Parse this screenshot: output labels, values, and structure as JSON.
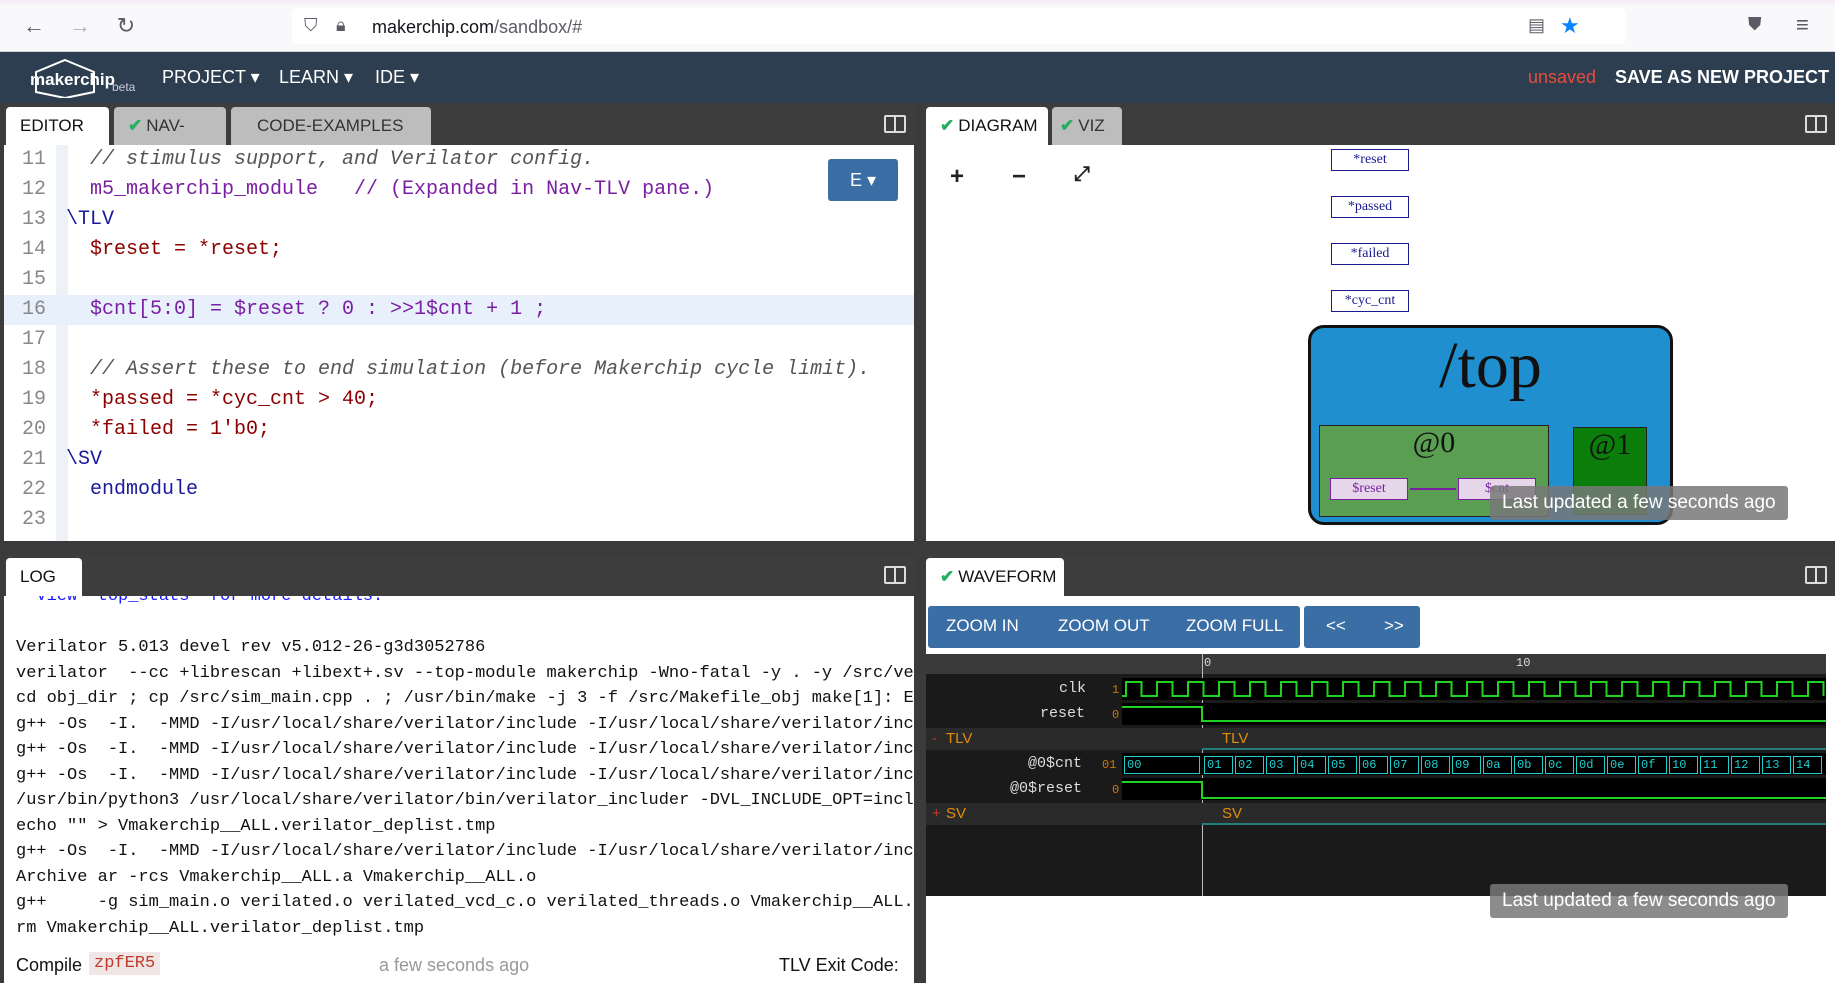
{
  "browser": {
    "url_host": "makerchip.com",
    "url_path": "/sandbox/#"
  },
  "app": {
    "logo": "makerchip",
    "beta": "beta",
    "menu": [
      "PROJECT ▾",
      "LEARN ▾",
      "IDE ▾"
    ],
    "unsaved": "unsaved",
    "save_new": "SAVE AS NEW PROJECT"
  },
  "editor_pane": {
    "tabs": [
      "EDITOR",
      "NAV-TLV",
      "CODE-EXAMPLES"
    ],
    "ebtn": "E ▾",
    "lines": [
      {
        "n": "11",
        "text": "  // stimulus support, and Verilator config."
      },
      {
        "n": "12",
        "text": "  m5_makerchip_module   // (Expanded in Nav-TLV pane.)"
      },
      {
        "n": "13",
        "text": "\\TLV"
      },
      {
        "n": "14",
        "text": "  $reset = *reset;"
      },
      {
        "n": "15",
        "text": ""
      },
      {
        "n": "16",
        "text": "  $cnt[5:0] = $reset ? 0 : >>1$cnt + 1 ;"
      },
      {
        "n": "17",
        "text": ""
      },
      {
        "n": "18",
        "text": "  // Assert these to end simulation (before Makerchip cycle limit)."
      },
      {
        "n": "19",
        "text": "  *passed = *cyc_cnt > 40;"
      },
      {
        "n": "20",
        "text": "  *failed = 1'b0;"
      },
      {
        "n": "21",
        "text": "\\SV"
      },
      {
        "n": "22",
        "text": "  endmodule"
      },
      {
        "n": "23",
        "text": ""
      }
    ]
  },
  "diagram_pane": {
    "tabs": [
      "DIAGRAM",
      "VIZ"
    ],
    "signals": [
      "*reset",
      "*passed",
      "*failed",
      "*cyc_cnt"
    ],
    "top": "/top",
    "stage0": "@0",
    "stage1": "@1",
    "reset_box": "$reset",
    "cnt_box": "$cnt",
    "toast": "Last updated a few seconds ago"
  },
  "log_pane": {
    "tab": "LOG",
    "lines": [
      "  View  top_stats  for more details.",
      "",
      "Verilator 5.013 devel rev v5.012-26-g3d3052786",
      "verilator  --cc +librescan +libext+.sv --top-module makerchip -Wno-fatal -y . -y /src/ve",
      "cd obj_dir ; cp /src/sim_main.cpp . ; /usr/bin/make -j 3 -f /src/Makefile_obj make[1]: E",
      "g++ -Os  -I.  -MMD -I/usr/local/share/verilator/include -I/usr/local/share/verilator/inc",
      "g++ -Os  -I.  -MMD -I/usr/local/share/verilator/include -I/usr/local/share/verilator/inc",
      "g++ -Os  -I.  -MMD -I/usr/local/share/verilator/include -I/usr/local/share/verilator/inc",
      "/usr/bin/python3 /usr/local/share/verilator/bin/verilator_includer -DVL_INCLUDE_OPT=incl",
      "echo \"\" > Vmakerchip__ALL.verilator_deplist.tmp",
      "g++ -Os  -I.  -MMD -I/usr/local/share/verilator/include -I/usr/local/share/verilator/inc",
      "Archive ar -rcs Vmakerchip__ALL.a Vmakerchip__ALL.o",
      "g++     -g sim_main.o verilated.o verilated_vcd_c.o verilated_threads.o Vmakerchip__ALL.",
      "rm Vmakerchip__ALL.verilator_deplist.tmp"
    ],
    "compile": "Compile",
    "compile_id": "zpfER5",
    "ago": "a few seconds ago",
    "exit": "TLV Exit Code:"
  },
  "wave_pane": {
    "tab": "WAVEFORM",
    "zoom": [
      "ZOOM IN",
      "ZOOM OUT",
      "ZOOM FULL"
    ],
    "nav": [
      "<<",
      ">>"
    ],
    "tick0": "0",
    "tick10": "10",
    "rows": [
      {
        "label": "clk",
        "val": "1"
      },
      {
        "label": "reset",
        "val": "0"
      },
      {
        "label": "TLV",
        "val": "-"
      },
      {
        "label": "@0$cnt",
        "val": "01"
      },
      {
        "label": "@0$reset",
        "val": "0"
      },
      {
        "label": "SV",
        "val": "+"
      }
    ],
    "grp_tlv": "TLV",
    "grp_sv": "SV",
    "cnt_values": [
      "00",
      "01",
      "02",
      "03",
      "04",
      "05",
      "06",
      "07",
      "08",
      "09",
      "0a",
      "0b",
      "0c",
      "0d",
      "0e",
      "0f",
      "10",
      "11",
      "12",
      "13",
      "14"
    ],
    "toast": "Last updated a few seconds ago"
  },
  "colors": {
    "accent": "#3a6ea5",
    "navbar": "#2c3e50",
    "unsaved": "#e74c3c",
    "wave_green": "#21d321",
    "wave_cyan": "#1fcfcf"
  }
}
